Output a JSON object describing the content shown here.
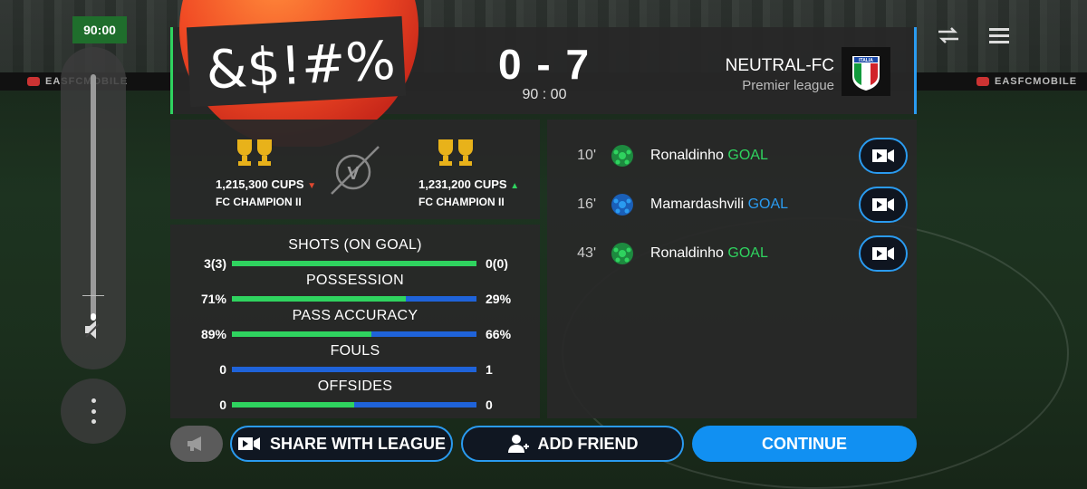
{
  "match_timer": "90:00",
  "adboard": {
    "text": "EASFCMOBILE"
  },
  "header": {
    "score_home": "0",
    "score_sep": "-",
    "score_away": "7",
    "time": "90 : 00",
    "away_team": "NEUTRAL-FC",
    "away_league": "Premier league",
    "emoji_text": "&$!#%"
  },
  "ranking": {
    "home": {
      "cups": "1,215,300 CUPS",
      "tier": "FC CHAMPION II",
      "trend": "down"
    },
    "away": {
      "cups": "1,231,200 CUPS",
      "tier": "FC CHAMPION II",
      "trend": "up"
    },
    "vs_label": "V"
  },
  "stats": [
    {
      "label": "SHOTS (ON GOAL)",
      "home": "3(3)",
      "away": "0(0)",
      "home_share": 1.0
    },
    {
      "label": "POSSESSION",
      "home": "71%",
      "away": "29%",
      "home_share": 0.71
    },
    {
      "label": "PASS ACCURACY",
      "home": "89%",
      "away": "66%",
      "home_share": 0.57
    },
    {
      "label": "FOULS",
      "home": "0",
      "away": "1",
      "home_share": 0.0
    },
    {
      "label": "OFFSIDES",
      "home": "0",
      "away": "0",
      "home_share": 0.5
    }
  ],
  "events": [
    {
      "minute": "10'",
      "player": "Ronaldinho",
      "event": "GOAL",
      "team": "home"
    },
    {
      "minute": "16'",
      "player": "Mamardashvili",
      "event": "GOAL",
      "team": "away"
    },
    {
      "minute": "43'",
      "player": "Ronaldinho",
      "event": "GOAL",
      "team": "home"
    }
  ],
  "buttons": {
    "share": "SHARE WITH LEAGUE",
    "add_friend": "ADD FRIEND",
    "continue": "CONTINUE"
  },
  "colors": {
    "home": "#2fd35f",
    "away": "#2a9bf0",
    "primary": "#1190f2"
  }
}
